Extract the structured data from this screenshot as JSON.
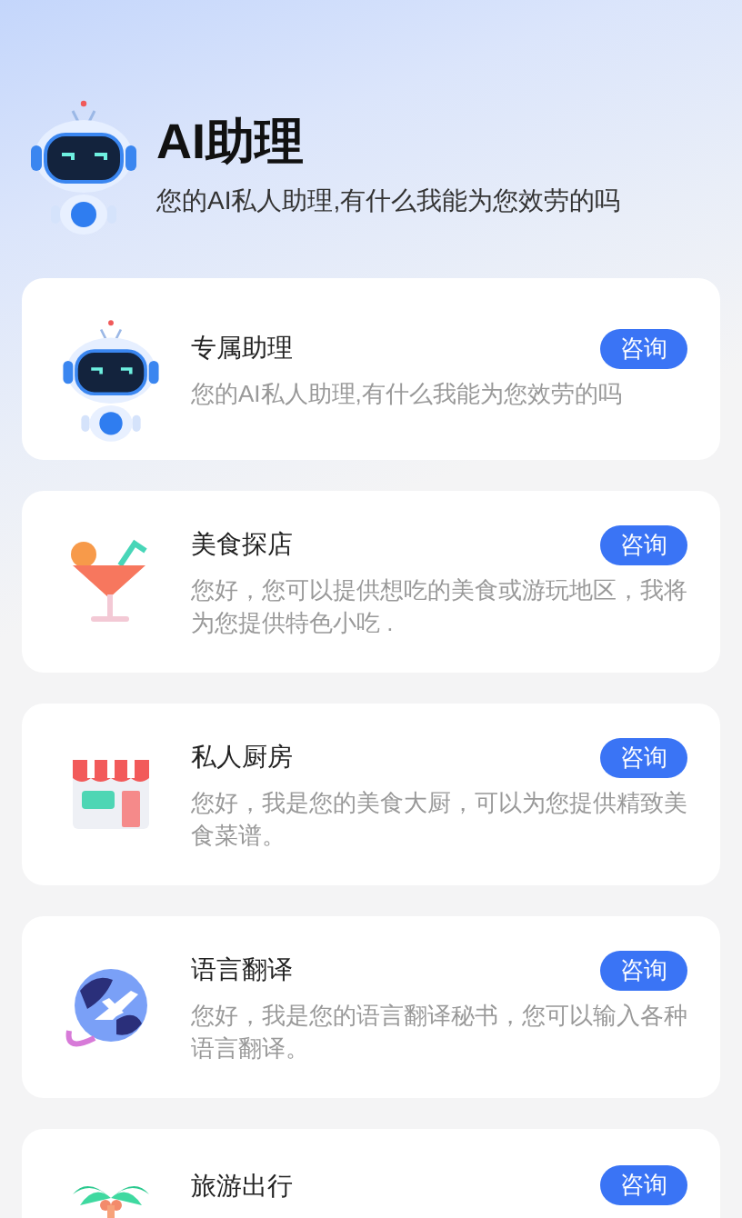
{
  "header": {
    "title": "AI助理",
    "subtitle": "您的AI私人助理,有什么我能为您效劳的吗"
  },
  "assistants": [
    {
      "kind": "robot",
      "title": "专属助理",
      "description": "您的AI私人助理,有什么我能为您效劳的吗",
      "button": "咨询"
    },
    {
      "kind": "cocktail",
      "title": "美食探店",
      "description": "您好，您可以提供想吃的美食或游玩地区，我将为您提供特色小吃 .",
      "button": "咨询"
    },
    {
      "kind": "shop",
      "title": "私人厨房",
      "description": "您好，我是您的美食大厨，可以为您提供精致美食菜谱。",
      "button": "咨询"
    },
    {
      "kind": "globe",
      "title": "语言翻译",
      "description": "您好，我是您的语言翻译秘书，您可以输入各种语言翻译。",
      "button": "咨询"
    },
    {
      "kind": "palm",
      "title": "旅游出行",
      "button": "咨询"
    }
  ]
}
